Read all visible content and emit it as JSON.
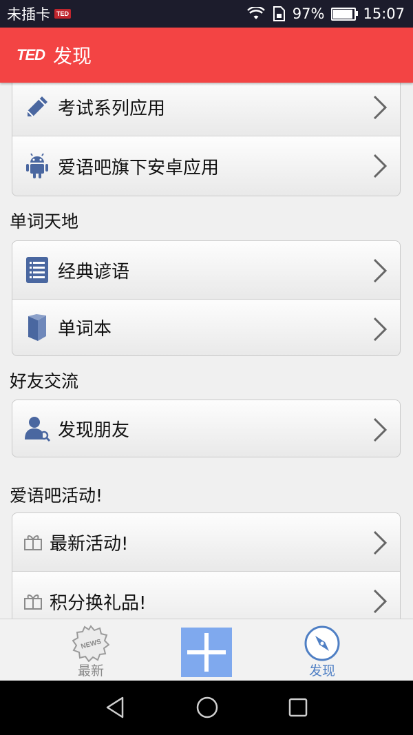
{
  "status_bar": {
    "carrier": "未插卡",
    "carrier_badge": "TED",
    "battery": "97%",
    "battery_level": 0.97,
    "time": "15:07"
  },
  "app_bar": {
    "logo": "TED",
    "title": "发现"
  },
  "groups": [
    {
      "title": "",
      "items": [
        {
          "label": "考试系列应用",
          "icon": "pencil-icon"
        },
        {
          "label": "爱语吧旗下安卓应用",
          "icon": "android-icon"
        }
      ]
    },
    {
      "title": "单词天地",
      "items": [
        {
          "label": "经典谚语",
          "icon": "list-icon"
        },
        {
          "label": "单词本",
          "icon": "book-icon"
        }
      ]
    },
    {
      "title": "好友交流",
      "items": [
        {
          "label": "发现朋友",
          "icon": "find-friend-icon"
        }
      ]
    },
    {
      "title": "爱语吧活动!",
      "items": [
        {
          "label": "最新活动!",
          "icon": "gift-icon"
        },
        {
          "label": "积分换礼品!",
          "icon": "gift-icon"
        }
      ]
    }
  ],
  "bottom_nav": {
    "news_label": "最新",
    "news_badge": "NEWS",
    "discover_label": "发现",
    "inactive_color": "#8a8a8a",
    "active_color": "#4f7fc4"
  },
  "colors": {
    "app_bar": "#f34444",
    "plus_button": "#7fa9ee",
    "icon_blue": "#4a67a0"
  }
}
